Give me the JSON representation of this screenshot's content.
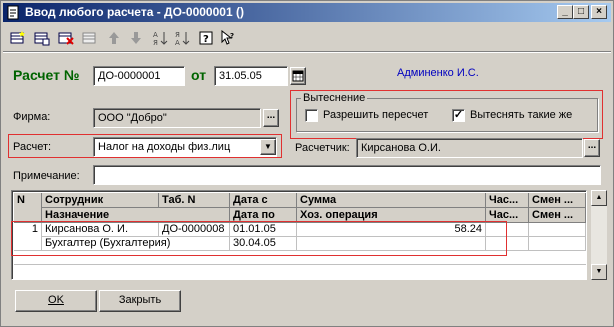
{
  "window": {
    "title": "Ввод любого расчета - ДО-0000001 ()",
    "controls": {
      "minimize": "_",
      "maximize": "□",
      "close": "×"
    }
  },
  "toolbar": {
    "icons": [
      "new-row-icon",
      "copy-row-icon",
      "delete-row-icon",
      "edit-row-icon",
      "move-up-icon",
      "move-down-icon",
      "sort-asc-icon",
      "sort-desc-icon",
      "help-icon",
      "context-help-icon"
    ]
  },
  "header": {
    "doc_label": "Расчет №",
    "doc_number": "ДО-0000001",
    "date_label": "от",
    "date_value": "31.05.05",
    "author": "Админенко И.С."
  },
  "firm": {
    "label": "Фирма:",
    "value": "ООО \"Добро\""
  },
  "exclusion": {
    "title": "Вытеснение",
    "allow_recalc_label": "Разрешить пересчет",
    "allow_recalc_checked": false,
    "exclude_same_label": "Вытеснять такие же",
    "exclude_same_checked": true
  },
  "calc": {
    "label": "Расчет:",
    "value": "Налог на доходы физ.лиц"
  },
  "calculator": {
    "label": "Расчетчик:",
    "value": "Кирсанова О.И."
  },
  "note": {
    "label": "Примечание:",
    "value": ""
  },
  "table": {
    "headers_top": [
      "N",
      "Сотрудник",
      "Таб. N",
      "Дата с",
      "Сумма",
      "Час...",
      "Смен ..."
    ],
    "headers_bottom": [
      "Назначение",
      "Дата по",
      "Хоз. операция",
      "Час...",
      "Смен ..."
    ],
    "rows": [
      {
        "n": "1",
        "employee": "Кирсанова О. И.",
        "tab": "ДО-0000008",
        "date_from": "01.01.05",
        "sum": "58.24",
        "assignment": "Бухгалтер (Бухгалтерия)",
        "date_to": "30.04.05",
        "operation": ""
      }
    ]
  },
  "buttons": {
    "ok": "OK",
    "close": "Закрыть"
  },
  "colors": {
    "titlebar_start": "#0a246a",
    "titlebar_end": "#a6caf0",
    "label_green": "#006400",
    "author_blue": "#0000c0",
    "highlight_red": "#e03030"
  }
}
